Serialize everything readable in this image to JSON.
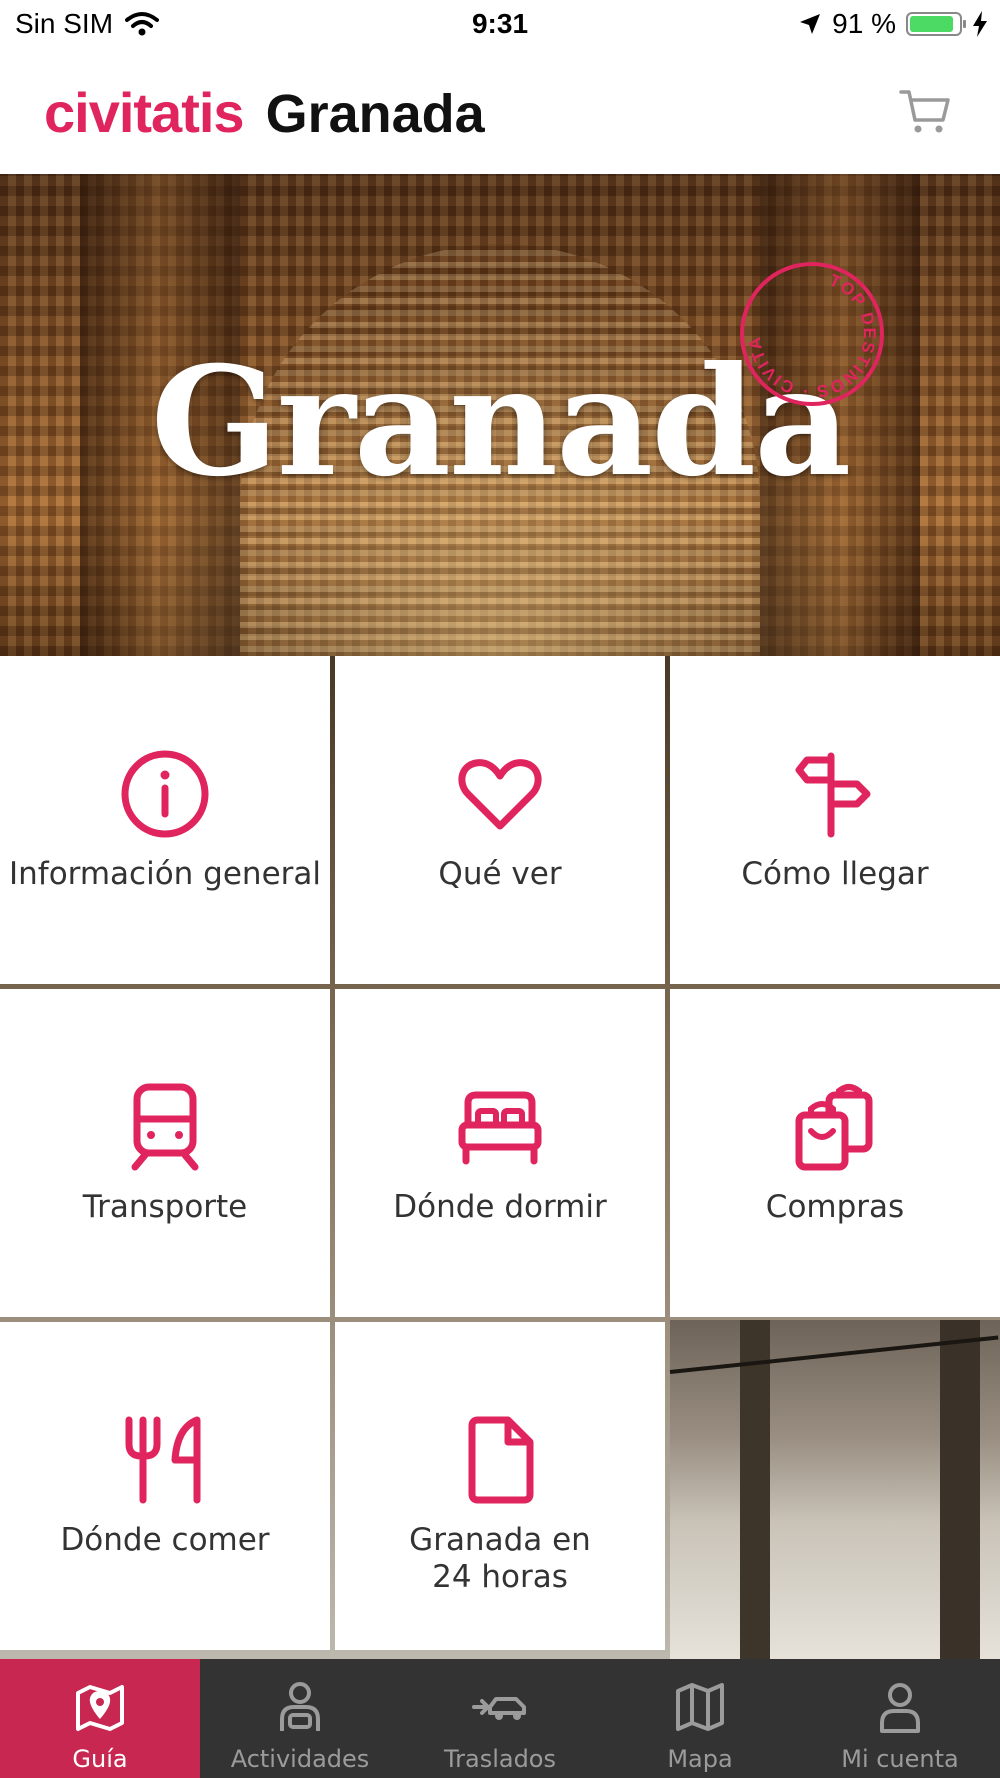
{
  "status_bar": {
    "carrier": "Sin SIM",
    "time": "9:31",
    "battery": "91 %",
    "battery_level": 0.91
  },
  "header": {
    "logo": "civitatis",
    "city": "Granada"
  },
  "hero": {
    "title": "Granada",
    "stamp_text": "TOP DESTINOS · CIVITATIS ·"
  },
  "menu": {
    "items": [
      {
        "label": "Información general",
        "icon": "info-icon"
      },
      {
        "label": "Qué ver",
        "icon": "heart-icon"
      },
      {
        "label": "Cómo llegar",
        "icon": "signpost-icon"
      },
      {
        "label": "Transporte",
        "icon": "train-icon"
      },
      {
        "label": "Dónde dormir",
        "icon": "bed-icon"
      },
      {
        "label": "Compras",
        "icon": "shopping-bags-icon"
      },
      {
        "label": "Dónde comer",
        "icon": "fork-knife-icon"
      },
      {
        "label": "Granada en 24 horas",
        "icon": "document-icon"
      }
    ]
  },
  "tabbar": {
    "tabs": [
      {
        "label": "Guía",
        "icon": "guide-map-icon",
        "active": true
      },
      {
        "label": "Actividades",
        "icon": "activities-icon",
        "active": false
      },
      {
        "label": "Traslados",
        "icon": "transfer-car-icon",
        "active": false
      },
      {
        "label": "Mapa",
        "icon": "map-icon",
        "active": false
      },
      {
        "label": "Mi cuenta",
        "icon": "account-icon",
        "active": false
      }
    ]
  },
  "colors": {
    "accent": "#e0245e",
    "tab_active": "#c72750",
    "tab_bar": "#333333"
  }
}
